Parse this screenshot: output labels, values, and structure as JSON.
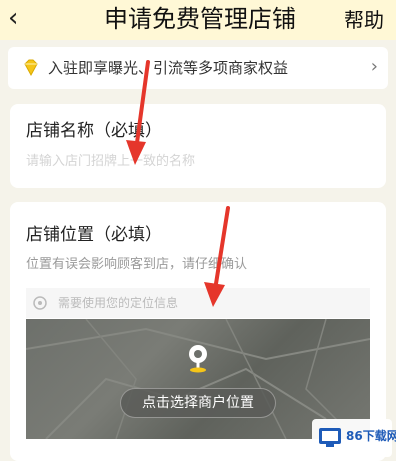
{
  "nav": {
    "back_icon": "chevron-left-icon",
    "title": "申请免费管理店铺",
    "help": "帮助"
  },
  "banner": {
    "icon": "diamond-icon",
    "text": "入驻即享曝光、引流等多项商家权益",
    "chevron_icon": "chevron-right-icon"
  },
  "store_name": {
    "label": "店铺名称（必填）",
    "placeholder": "请输入店门招牌上一致的名称",
    "value": ""
  },
  "store_location": {
    "label": "店铺位置（必填）",
    "hint": "位置有误会影响顾客到店，请仔细确认",
    "permission_text": "需要使用您的定位信息",
    "map": {
      "pin_icon": "location-pin-icon",
      "select_button": "点击选择商户位置"
    }
  },
  "annotations": {
    "arrow_color": "#e5362b"
  },
  "watermark": {
    "text": "86下载网"
  },
  "colors": {
    "nav_background": "#fff8d6",
    "page_background": "#f5f3ea",
    "card_background": "#ffffff",
    "accent_yellow": "#f5c518"
  }
}
